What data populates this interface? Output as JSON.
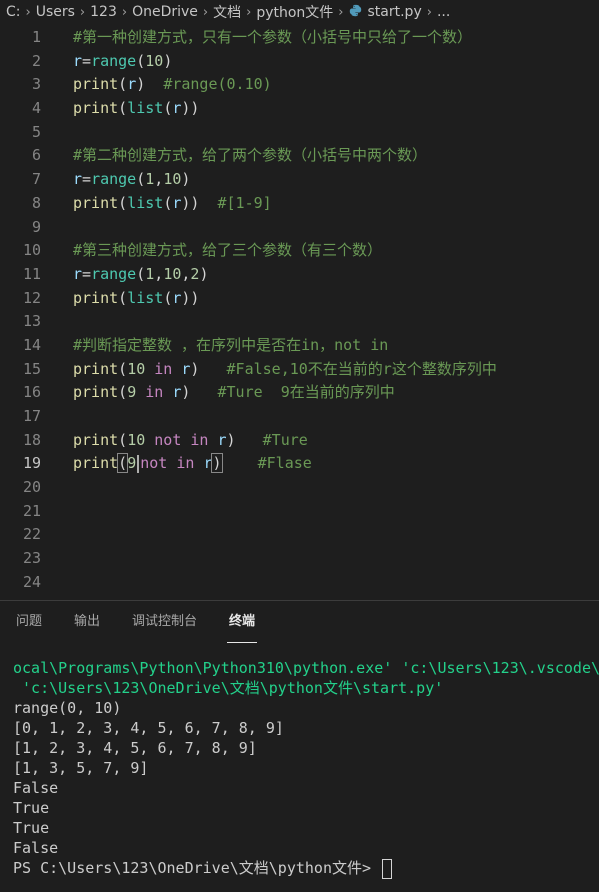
{
  "breadcrumb": {
    "items": [
      "C:",
      "Users",
      "123",
      "OneDrive",
      "文档",
      "python文件",
      "start.py",
      "..."
    ],
    "file_icon": "python-file-icon"
  },
  "editor": {
    "active_line": 19,
    "lines": [
      {
        "no": "1",
        "text": "#第一种创建方式，只有一个参数（小括号中只给了一个数）"
      },
      {
        "no": "2",
        "text": "r=range(10)"
      },
      {
        "no": "3",
        "text": "print(r)  #range(0.10)"
      },
      {
        "no": "4",
        "text": "print(list(r))"
      },
      {
        "no": "5",
        "text": ""
      },
      {
        "no": "6",
        "text": "#第二种创建方式，给了两个参数（小括号中两个数）"
      },
      {
        "no": "7",
        "text": "r=range(1,10)"
      },
      {
        "no": "8",
        "text": "print(list(r))  #[1-9]"
      },
      {
        "no": "9",
        "text": ""
      },
      {
        "no": "10",
        "text": "#第三种创建方式，给了三个参数（有三个数）"
      },
      {
        "no": "11",
        "text": "r=range(1,10,2)"
      },
      {
        "no": "12",
        "text": "print(list(r))"
      },
      {
        "no": "13",
        "text": ""
      },
      {
        "no": "14",
        "text": "#判断指定整数 ，在序列中是否在in，not in"
      },
      {
        "no": "15",
        "text": "print(10 in r)   #False,10不在当前的r这个整数序列中"
      },
      {
        "no": "16",
        "text": "print(9 in r)   #Ture  9在当前的序列中"
      },
      {
        "no": "17",
        "text": ""
      },
      {
        "no": "18",
        "text": "print(10 not in r)   #Ture"
      },
      {
        "no": "19",
        "text": "print(9 not in r)    #Flase"
      },
      {
        "no": "20",
        "text": ""
      },
      {
        "no": "21",
        "text": ""
      },
      {
        "no": "22",
        "text": ""
      },
      {
        "no": "23",
        "text": ""
      },
      {
        "no": "24",
        "text": ""
      }
    ]
  },
  "panel": {
    "tabs": [
      "问题",
      "输出",
      "调试控制台",
      "终端"
    ],
    "active_tab": "终端"
  },
  "terminal": {
    "cmd_line1": "ocal\\Programs\\Python\\Python310\\python.exe' 'c:\\Users\\123\\.vscode\\",
    "cmd_line2": " 'c:\\Users\\123\\OneDrive\\文档\\python文件\\start.py'",
    "output": [
      "range(0, 10)",
      "[0, 1, 2, 3, 4, 5, 6, 7, 8, 9]",
      "[1, 2, 3, 4, 5, 6, 7, 8, 9]",
      "[1, 3, 5, 7, 9]",
      "False",
      "True",
      "True",
      "False"
    ],
    "prompt": "PS C:\\Users\\123\\OneDrive\\文档\\python文件> "
  },
  "colors": {
    "background": "#1e1e1e",
    "comment": "#6a9955",
    "function": "#dcdcaa",
    "builtin": "#4ec9b0",
    "number": "#b5cea8",
    "variable": "#9cdcfe",
    "keyword": "#c586c0",
    "terminal_command": "#23d18b"
  }
}
